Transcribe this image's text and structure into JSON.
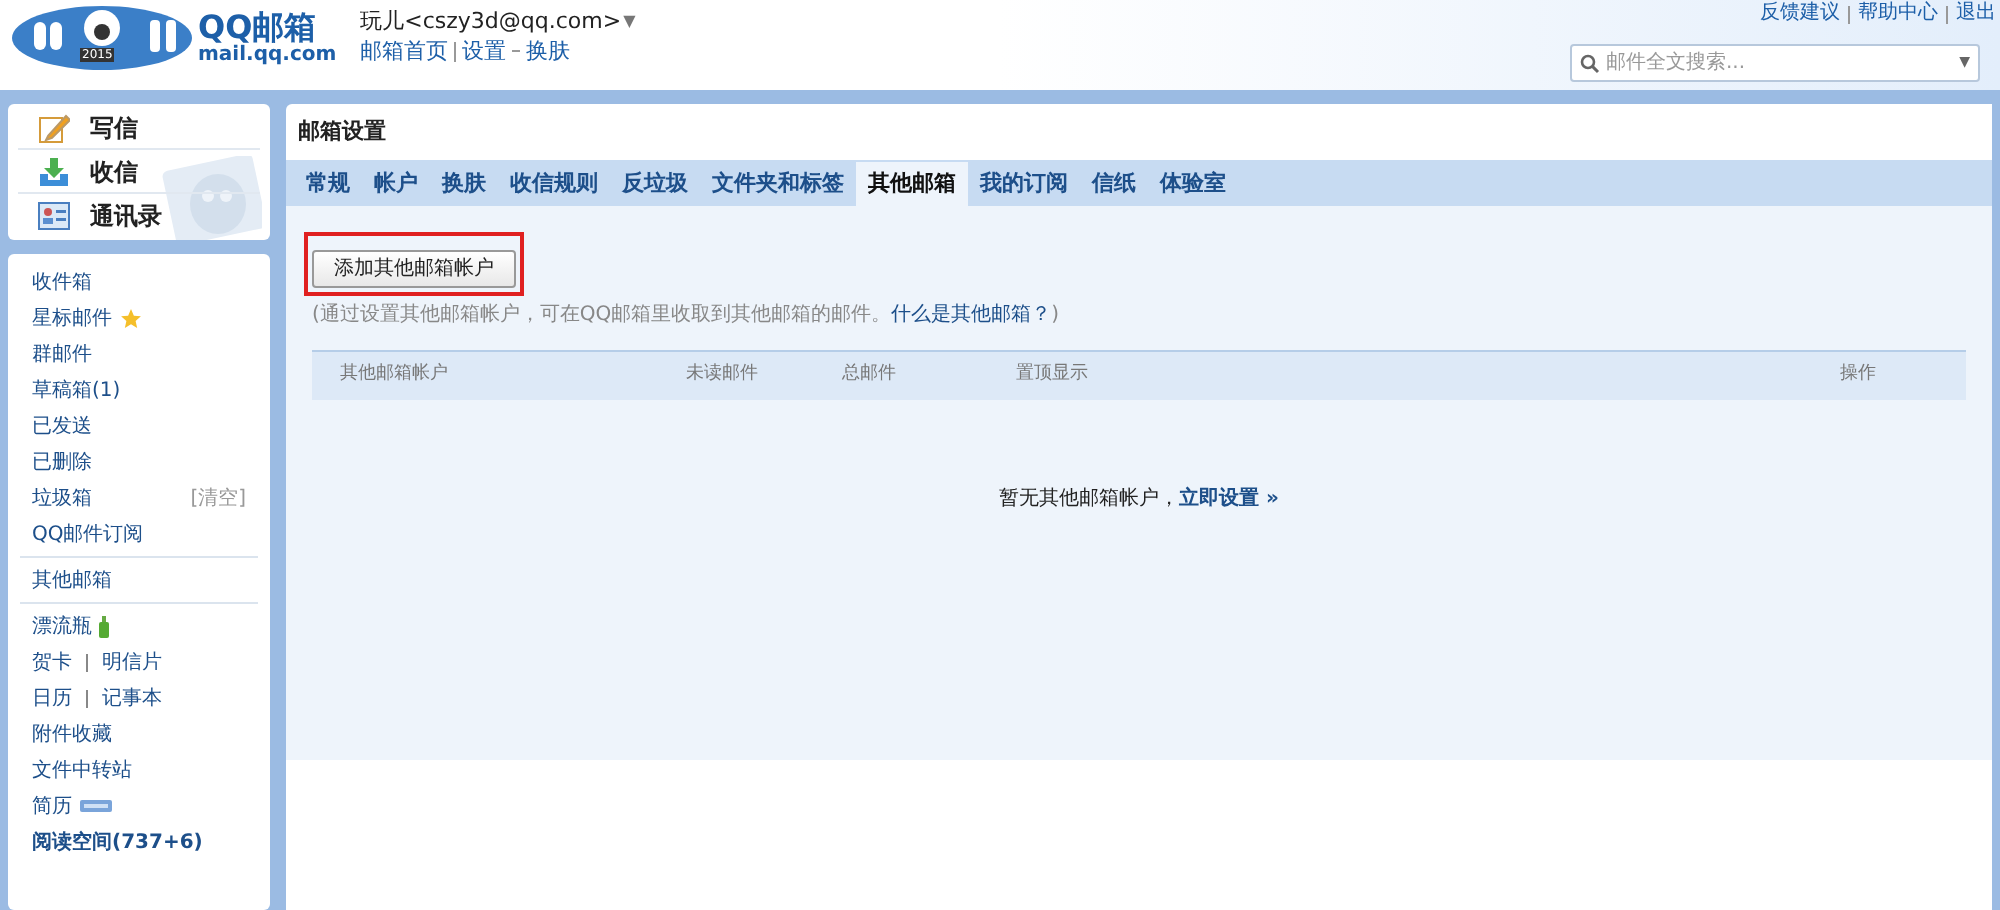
{
  "header": {
    "logo_title": "QQ邮箱",
    "logo_domain": "mail.qq.com",
    "logo_year": "2015",
    "user": "玩儿<cszy3d@qq.com>",
    "user_caret": "▼",
    "links": [
      "邮箱首页",
      "设置",
      "换肤"
    ],
    "top_links": [
      "反馈建议",
      "帮助中心",
      "退出"
    ],
    "search": {
      "placeholder": "邮件全文搜索...",
      "caret": "▼"
    }
  },
  "quick_actions": [
    {
      "kind": "write",
      "label": "写信"
    },
    {
      "kind": "receive",
      "label": "收信"
    },
    {
      "kind": "contacts",
      "label": "通讯录"
    }
  ],
  "folders": [
    {
      "label": "收件箱",
      "kind": "plain"
    },
    {
      "label": "星标邮件",
      "kind": "star"
    },
    {
      "label": "群邮件",
      "kind": "plain"
    },
    {
      "label": "草稿箱(1)",
      "kind": "plain"
    },
    {
      "label": "已发送",
      "kind": "plain"
    },
    {
      "label": "已删除",
      "kind": "plain"
    },
    {
      "label": "垃圾箱",
      "kind": "plain",
      "action": "[清空]"
    },
    {
      "label": "QQ邮件订阅",
      "kind": "plain"
    }
  ],
  "other_mail": "其他邮箱",
  "apps": [
    {
      "labels": [
        "漂流瓶"
      ],
      "kind": "bottle"
    },
    {
      "labels": [
        "贺卡",
        "明信片"
      ],
      "kind": "pair"
    },
    {
      "labels": [
        "日历",
        "记事本"
      ],
      "kind": "pair"
    },
    {
      "labels": [
        "附件收藏"
      ],
      "kind": "plain"
    },
    {
      "labels": [
        "文件中转站"
      ],
      "kind": "plain"
    },
    {
      "labels": [
        "简历"
      ],
      "kind": "beta"
    },
    {
      "labels": [
        "阅读空间(737+6)"
      ],
      "kind": "bold"
    }
  ],
  "main": {
    "title": "邮箱设置",
    "tabs": [
      {
        "label": "常规",
        "selected": false
      },
      {
        "label": "帐户",
        "selected": false
      },
      {
        "label": "换肤",
        "selected": false
      },
      {
        "label": "收信规则",
        "selected": false
      },
      {
        "label": "反垃圾",
        "selected": false
      },
      {
        "label": "文件夹和标签",
        "selected": false
      },
      {
        "label": "其他邮箱",
        "selected": true
      },
      {
        "label": "我的订阅",
        "selected": false
      },
      {
        "label": "信纸",
        "selected": false
      },
      {
        "label": "体验室",
        "selected": false
      }
    ],
    "add_button": "添加其他邮箱帐户",
    "hint": "(通过设置其他邮箱帐户，可在QQ邮箱里收取到其他邮箱的邮件。",
    "hint_link": "什么是其他邮箱？",
    "hint_end": ")",
    "table": {
      "columns": [
        "其他邮箱帐户",
        "未读邮件",
        "总邮件",
        "置顶显示",
        "操作"
      ]
    },
    "empty": "暂无其他邮箱帐户，",
    "empty_link": "立即设置 »"
  }
}
